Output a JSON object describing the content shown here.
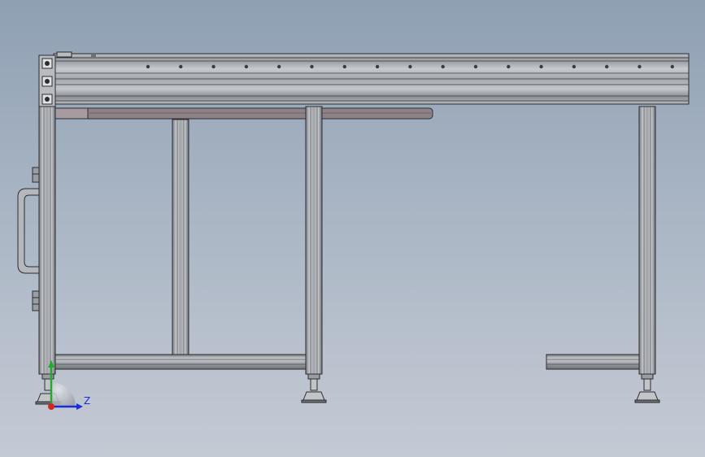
{
  "viewport": {
    "background_top": "#8fa0b3",
    "background_bottom": "#c4cad4",
    "model": "aluminum-profile-conveyor-frame"
  },
  "colors": {
    "profile_fill": "#a7aaaf",
    "profile_light": "#c9ccd1",
    "profile_dark": "#6d7075",
    "edge": "#2b2d31",
    "belt_fill": "#8e8288",
    "foot_fill": "#c2c4c8"
  },
  "triad": {
    "z_label": "Z",
    "x_color": "#d8261d",
    "y_color": "#1fae2a",
    "z_color": "#1a2bd8"
  },
  "icons": {
    "orientation_triad": "coordinate-axes-icon"
  }
}
